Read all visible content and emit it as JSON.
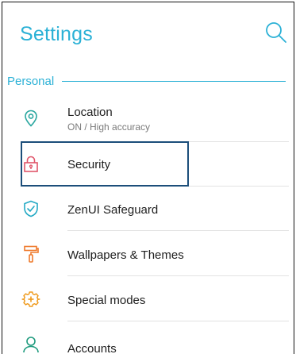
{
  "header": {
    "title": "Settings"
  },
  "sections": [
    {
      "label": "Personal"
    }
  ],
  "items": [
    {
      "name": "location",
      "label": "Location",
      "sublabel": "ON / High accuracy",
      "icon": "location-pin-icon",
      "icon_color": "#2aa7a0"
    },
    {
      "name": "security",
      "label": "Security",
      "icon": "lock-icon",
      "icon_color": "#e0566b",
      "focused": true
    },
    {
      "name": "zenui-safeguard",
      "label": "ZenUI Safeguard",
      "icon": "shield-check-icon",
      "icon_color": "#23a9c4"
    },
    {
      "name": "wallpapers-themes",
      "label": "Wallpapers & Themes",
      "icon": "paint-roller-icon",
      "icon_color": "#ee7a2c"
    },
    {
      "name": "special-modes",
      "label": "Special modes",
      "icon": "gear-plus-icon",
      "icon_color": "#ef9a1c"
    },
    {
      "name": "accounts",
      "label": "Accounts",
      "icon": "person-icon",
      "icon_color": "#1f9b7e"
    }
  ],
  "colors": {
    "accent": "#2bb1d6",
    "focus_border": "#1c4e7a"
  }
}
